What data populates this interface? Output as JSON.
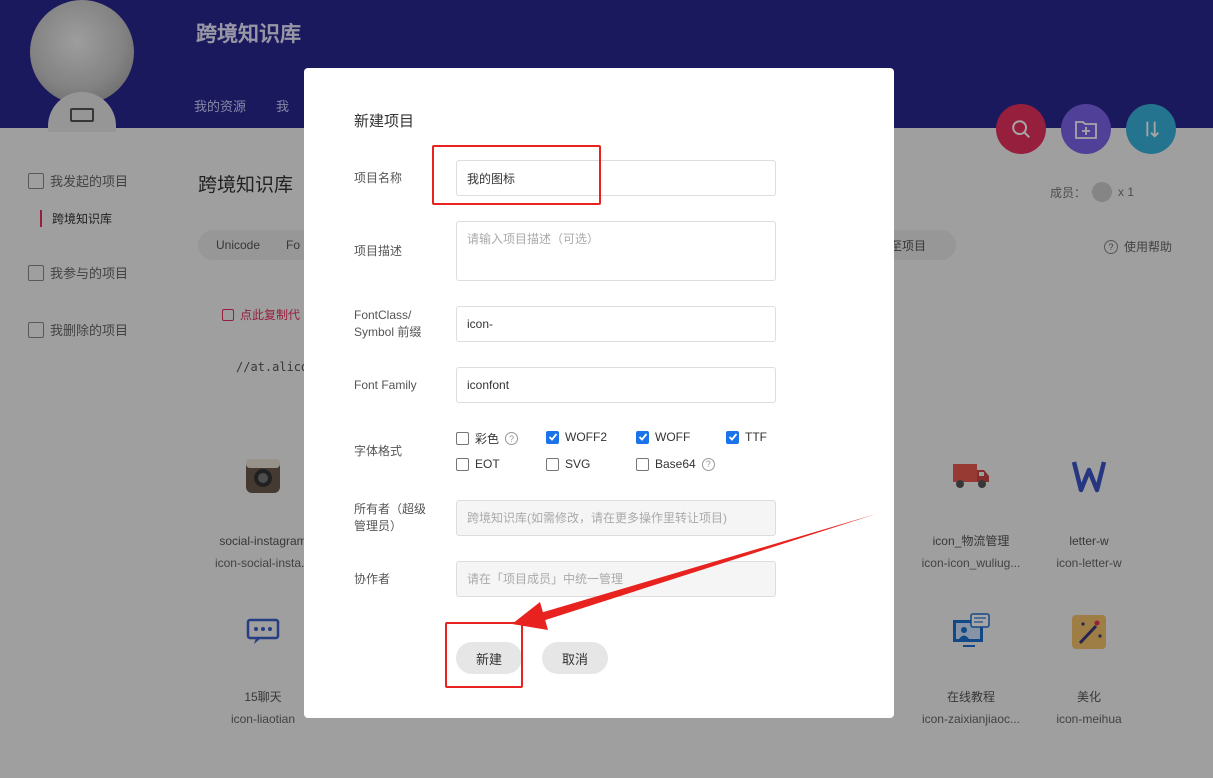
{
  "header": {
    "brand": "跨境知识库",
    "nav": [
      "我的资源",
      "我"
    ]
  },
  "sidebar": {
    "items": [
      {
        "label": "我发起的项目"
      },
      {
        "label": "我参与的项目"
      },
      {
        "label": "我删除的项目"
      }
    ],
    "active_project": "跨境知识库"
  },
  "main": {
    "title": "跨境知识库",
    "tabs": [
      "Unicode",
      "Fo"
    ],
    "upload_button": "至项目",
    "members_label": "成员：",
    "members_count": "x 1",
    "help": "使用帮助",
    "copy_code": "点此复制代",
    "code_url": "//at.alicd"
  },
  "icons": [
    {
      "name": "social-instagram",
      "class": "icon-social-insta..."
    },
    {
      "name": "icon_物流管理",
      "class": "icon-icon_wuliug..."
    },
    {
      "name": "letter-w",
      "class": "icon-letter-w"
    },
    {
      "name": "15聊天",
      "class": "icon-liaotian"
    },
    {
      "name": "在线教程",
      "class": "icon-zaixianjiaoc..."
    },
    {
      "name": "美化",
      "class": "icon-meihua"
    }
  ],
  "modal": {
    "title": "新建项目",
    "fields": {
      "name": {
        "label": "项目名称",
        "value": "我的图标"
      },
      "desc": {
        "label": "项目描述",
        "placeholder": "请输入项目描述（可选）"
      },
      "prefix": {
        "label_1": "FontClass/",
        "label_2": "Symbol 前缀",
        "value": "icon-"
      },
      "family": {
        "label": "Font Family",
        "value": "iconfont"
      },
      "formats": {
        "label": "字体格式",
        "options": [
          {
            "label": "彩色",
            "checked": false,
            "help": "?"
          },
          {
            "label": "WOFF2",
            "checked": true
          },
          {
            "label": "WOFF",
            "checked": true
          },
          {
            "label": "TTF",
            "checked": true
          },
          {
            "label": "EOT",
            "checked": false
          },
          {
            "label": "SVG",
            "checked": false
          },
          {
            "label": "Base64",
            "checked": false,
            "help": "?"
          }
        ]
      },
      "owner": {
        "label_1": "所有者（超级",
        "label_2": "管理员）",
        "placeholder": "跨境知识库(如需修改，请在更多操作里转让项目)"
      },
      "collab": {
        "label": "协作者",
        "placeholder": "请在「项目成员」中统一管理"
      }
    },
    "buttons": {
      "create": "新建",
      "cancel": "取消"
    }
  },
  "colors": {
    "header_bg": "#2a2790",
    "accent_pink": "#e6315e",
    "checkbox_blue": "#1a73e8",
    "annotation_red": "#e8231f"
  }
}
